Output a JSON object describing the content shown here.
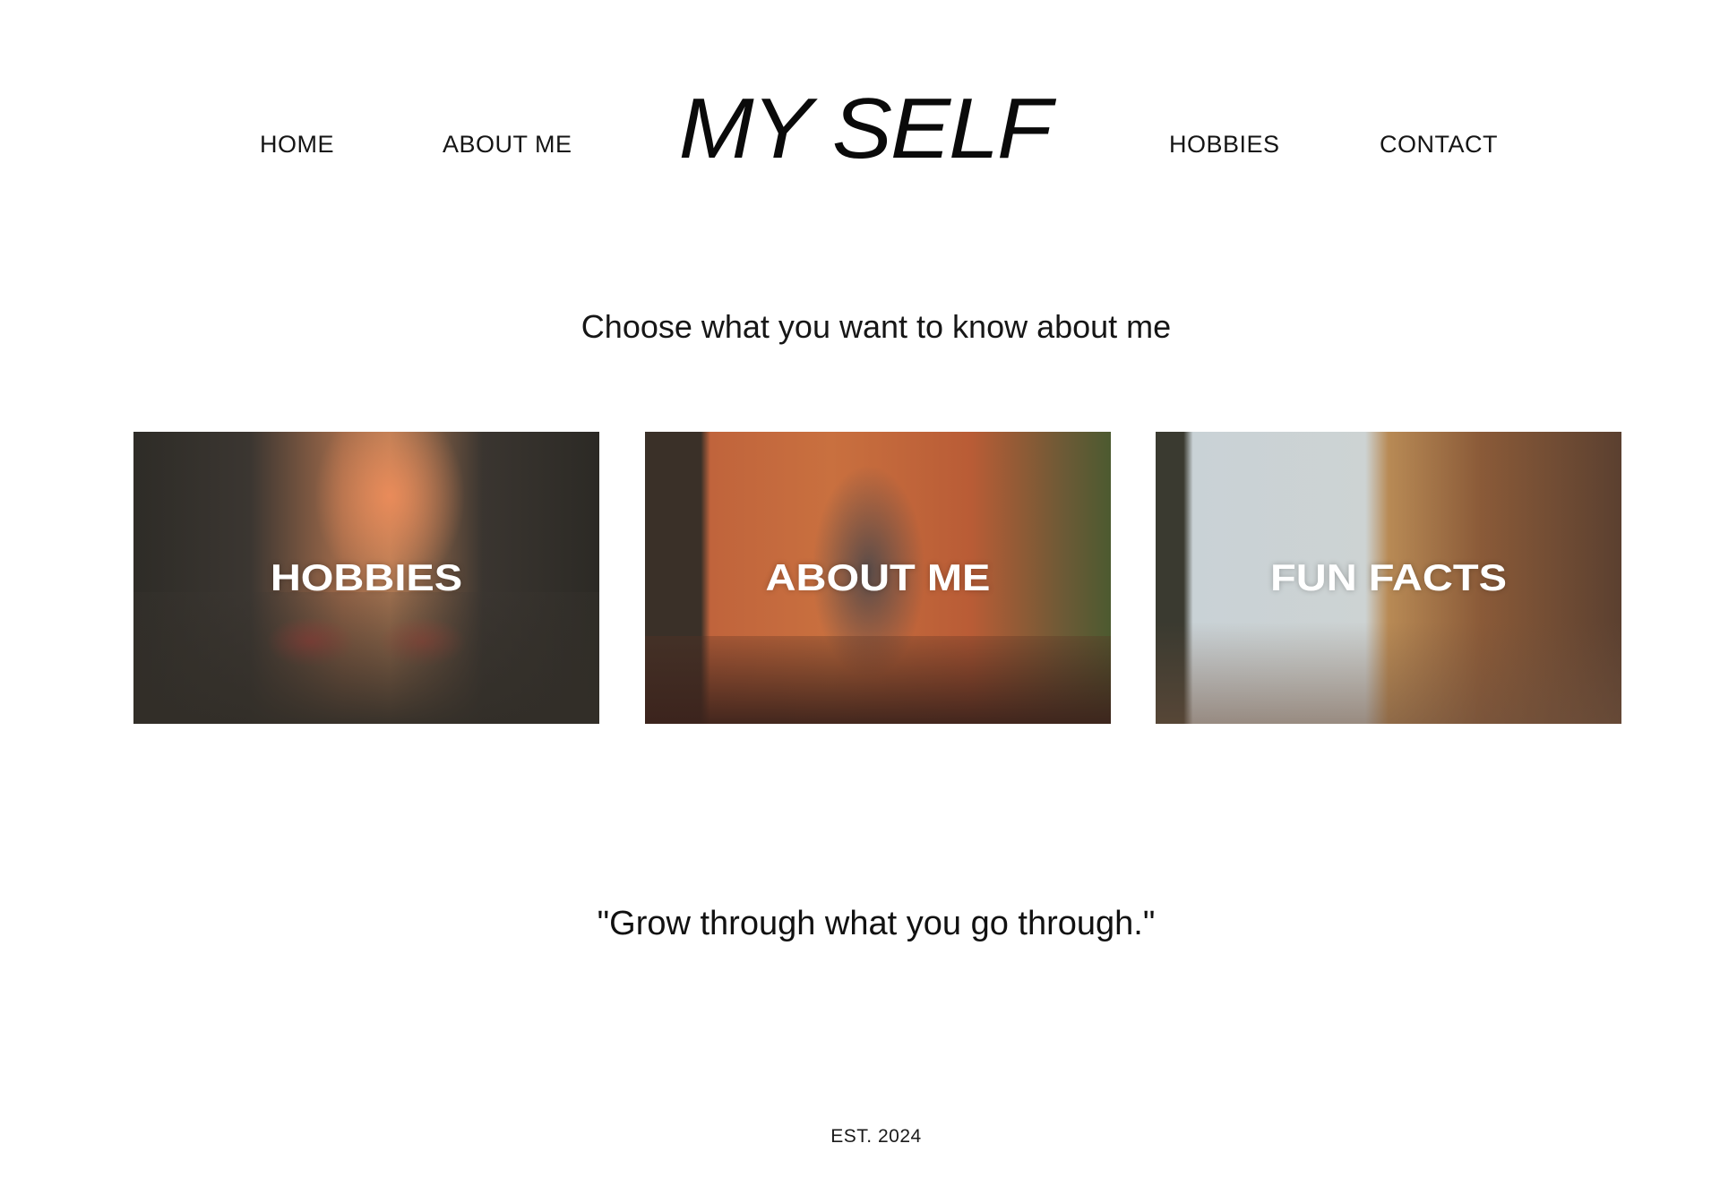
{
  "header": {
    "nav_left": [
      "HOME",
      "ABOUT ME"
    ],
    "logo": "MY SELF",
    "nav_right": [
      "HOBBIES",
      "CONTACT"
    ]
  },
  "main": {
    "subtitle": "Choose what you want to know about me",
    "cards": [
      {
        "label": "HOBBIES",
        "image": "city-street-dusk-photo"
      },
      {
        "label": "ABOUT ME",
        "image": "person-brick-wall-photo"
      },
      {
        "label": "FUN FACTS",
        "image": "building-sky-photo"
      }
    ],
    "quote": "\"Grow through what you go through.\""
  },
  "footer": {
    "est": "EST. 2024"
  },
  "colors": {
    "background": "#ffffff",
    "text": "#111111",
    "card_label": "#ffffff"
  }
}
